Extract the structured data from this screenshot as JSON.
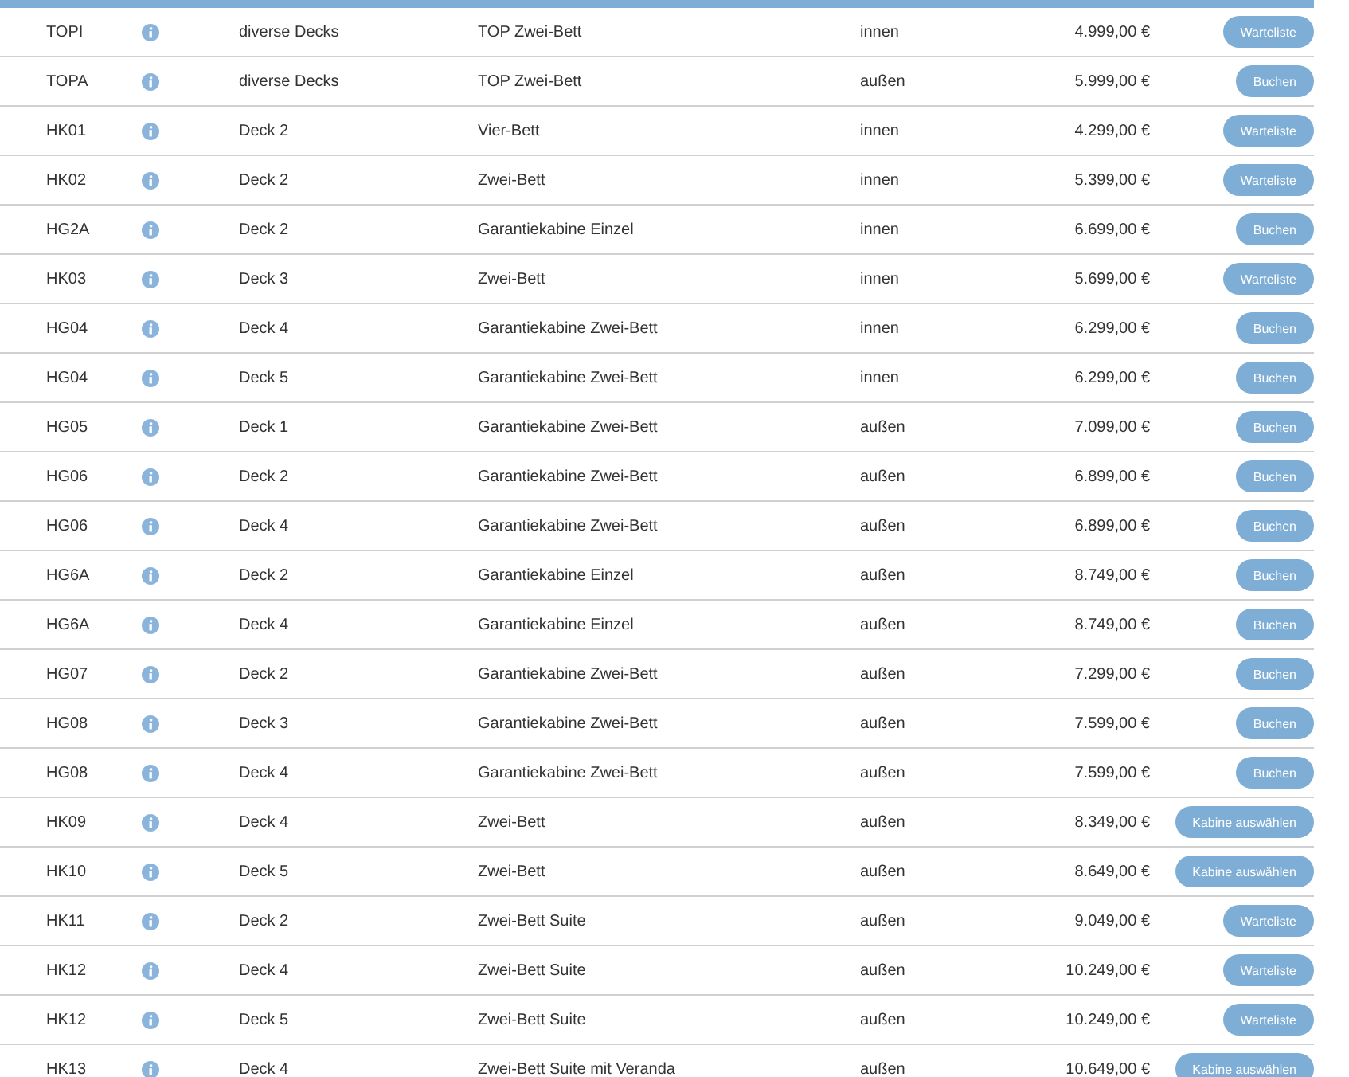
{
  "rows": [
    {
      "code": "TOPI",
      "deck": "diverse Decks",
      "cabin": "TOP Zwei-Bett",
      "side": "innen",
      "price": "4.999,00 €",
      "action": "Warteliste"
    },
    {
      "code": "TOPA",
      "deck": "diverse Decks",
      "cabin": "TOP Zwei-Bett",
      "side": "außen",
      "price": "5.999,00 €",
      "action": "Buchen"
    },
    {
      "code": "HK01",
      "deck": "Deck 2",
      "cabin": "Vier-Bett",
      "side": "innen",
      "price": "4.299,00 €",
      "action": "Warteliste"
    },
    {
      "code": "HK02",
      "deck": "Deck 2",
      "cabin": "Zwei-Bett",
      "side": "innen",
      "price": "5.399,00 €",
      "action": "Warteliste"
    },
    {
      "code": "HG2A",
      "deck": "Deck 2",
      "cabin": "Garantiekabine Einzel",
      "side": "innen",
      "price": "6.699,00 €",
      "action": "Buchen"
    },
    {
      "code": "HK03",
      "deck": "Deck 3",
      "cabin": "Zwei-Bett",
      "side": "innen",
      "price": "5.699,00 €",
      "action": "Warteliste"
    },
    {
      "code": "HG04",
      "deck": "Deck 4",
      "cabin": "Garantiekabine Zwei-Bett",
      "side": "innen",
      "price": "6.299,00 €",
      "action": "Buchen"
    },
    {
      "code": "HG04",
      "deck": "Deck 5",
      "cabin": "Garantiekabine Zwei-Bett",
      "side": "innen",
      "price": "6.299,00 €",
      "action": "Buchen"
    },
    {
      "code": "HG05",
      "deck": "Deck 1",
      "cabin": "Garantiekabine Zwei-Bett",
      "side": "außen",
      "price": "7.099,00 €",
      "action": "Buchen"
    },
    {
      "code": "HG06",
      "deck": "Deck 2",
      "cabin": "Garantiekabine Zwei-Bett",
      "side": "außen",
      "price": "6.899,00 €",
      "action": "Buchen"
    },
    {
      "code": "HG06",
      "deck": "Deck 4",
      "cabin": "Garantiekabine Zwei-Bett",
      "side": "außen",
      "price": "6.899,00 €",
      "action": "Buchen"
    },
    {
      "code": "HG6A",
      "deck": "Deck 2",
      "cabin": "Garantiekabine Einzel",
      "side": "außen",
      "price": "8.749,00 €",
      "action": "Buchen"
    },
    {
      "code": "HG6A",
      "deck": "Deck 4",
      "cabin": "Garantiekabine Einzel",
      "side": "außen",
      "price": "8.749,00 €",
      "action": "Buchen"
    },
    {
      "code": "HG07",
      "deck": "Deck 2",
      "cabin": "Garantiekabine Zwei-Bett",
      "side": "außen",
      "price": "7.299,00 €",
      "action": "Buchen"
    },
    {
      "code": "HG08",
      "deck": "Deck 3",
      "cabin": "Garantiekabine Zwei-Bett",
      "side": "außen",
      "price": "7.599,00 €",
      "action": "Buchen"
    },
    {
      "code": "HG08",
      "deck": "Deck 4",
      "cabin": "Garantiekabine Zwei-Bett",
      "side": "außen",
      "price": "7.599,00 €",
      "action": "Buchen"
    },
    {
      "code": "HK09",
      "deck": "Deck 4",
      "cabin": "Zwei-Bett",
      "side": "außen",
      "price": "8.349,00 €",
      "action": "Kabine auswählen"
    },
    {
      "code": "HK10",
      "deck": "Deck 5",
      "cabin": "Zwei-Bett",
      "side": "außen",
      "price": "8.649,00 €",
      "action": "Kabine auswählen"
    },
    {
      "code": "HK11",
      "deck": "Deck 2",
      "cabin": "Zwei-Bett Suite",
      "side": "außen",
      "price": "9.049,00 €",
      "action": "Warteliste"
    },
    {
      "code": "HK12",
      "deck": "Deck 4",
      "cabin": "Zwei-Bett Suite",
      "side": "außen",
      "price": "10.249,00 €",
      "action": "Warteliste"
    },
    {
      "code": "HK12",
      "deck": "Deck 5",
      "cabin": "Zwei-Bett Suite",
      "side": "außen",
      "price": "10.249,00 €",
      "action": "Warteliste"
    },
    {
      "code": "HK13",
      "deck": "Deck 4",
      "cabin": "Zwei-Bett Suite mit Veranda",
      "side": "außen",
      "price": "10.649,00 €",
      "action": "Kabine auswählen"
    }
  ]
}
